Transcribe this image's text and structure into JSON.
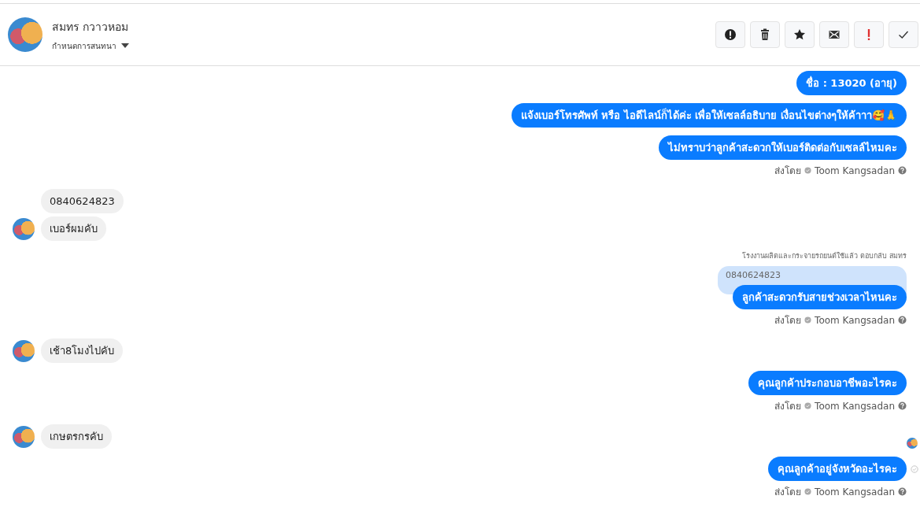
{
  "header": {
    "name": "สมทร กวาวหอม",
    "subtitle": "กำหนดการสนทนา",
    "actions": [
      {
        "kind": "alert"
      },
      {
        "kind": "trash"
      },
      {
        "kind": "star"
      },
      {
        "kind": "mail"
      },
      {
        "kind": "important"
      },
      {
        "kind": "check"
      }
    ]
  },
  "messages": [
    {
      "kind": "out",
      "text": "ชื่อ : 13020 (อายุ)",
      "delivered": false
    },
    {
      "kind": "out",
      "text": "แจ้งเบอร์โทรศัพท์ หรือ ไอดีไลน์ก็ได้ค่ะ เพื่อให้เซลล์อธิบาย เงื่อนไขต่างๆให้ค้าาา🥰🙏",
      "delivered": false
    },
    {
      "kind": "out",
      "text": "ไม่ทราบว่าลูกค้าสะดวกให้เบอร์ติดต่อกับเซลล์ไหมคะ",
      "delivered": false
    },
    {
      "kind": "sent_by",
      "label": "ส่งโดย",
      "agent": "Toom Kangsadan"
    },
    {
      "kind": "in",
      "text": "0840624823",
      "avatar": false
    },
    {
      "kind": "in",
      "text": "เบอร์ผมคับ",
      "avatar": true
    },
    {
      "kind": "reply_note",
      "text": "โรงงานผลิตและกระจายรถยนต์ใช้แล้ว ตอบกลับ สมทร"
    },
    {
      "kind": "quote",
      "text": "0840624823"
    },
    {
      "kind": "out",
      "text": "ลูกค้าสะดวกรับสายช่วงเวลาไหนคะ",
      "delivered": false
    },
    {
      "kind": "sent_by",
      "label": "ส่งโดย",
      "agent": "Toom Kangsadan"
    },
    {
      "kind": "in",
      "text": "เช้า8โมงไปคับ",
      "avatar": true
    },
    {
      "kind": "out",
      "text": "คุณลูกค้าประกอบอาชีพอะไรคะ",
      "delivered": false
    },
    {
      "kind": "sent_by",
      "label": "ส่งโดย",
      "agent": "Toom Kangsadan"
    },
    {
      "kind": "in",
      "text": "เกษตรกรคับ",
      "avatar": true
    },
    {
      "kind": "seen"
    },
    {
      "kind": "out",
      "text": "คุณลูกค้าอยู่จังหวัดอะไรคะ",
      "delivered": true
    },
    {
      "kind": "sent_by",
      "label": "ส่งโดย",
      "agent": "Toom Kangsadan"
    }
  ]
}
